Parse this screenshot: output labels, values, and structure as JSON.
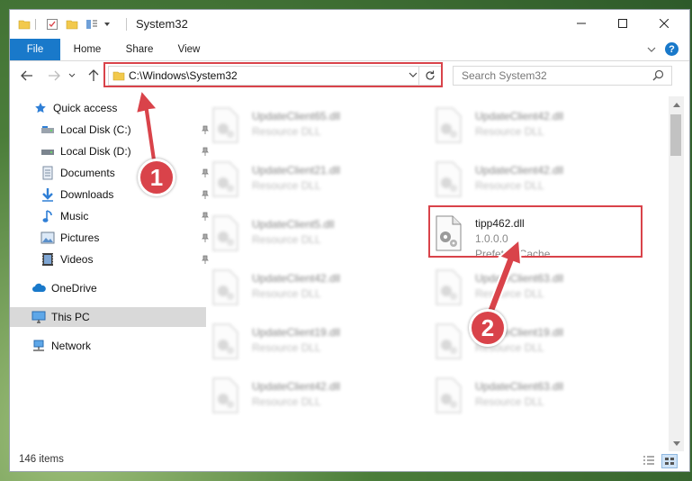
{
  "window": {
    "title": "System32"
  },
  "ribbon": {
    "tabs": [
      "File",
      "Home",
      "Share",
      "View"
    ]
  },
  "address": {
    "path": "C:\\Windows\\System32"
  },
  "search": {
    "placeholder": "Search System32"
  },
  "nav": {
    "quick_access": "Quick access",
    "items": [
      {
        "label": "Local Disk (C:)",
        "icon": "drive-icon"
      },
      {
        "label": "Local Disk (D:)",
        "icon": "drive-icon"
      },
      {
        "label": "Documents",
        "icon": "documents-icon"
      },
      {
        "label": "Downloads",
        "icon": "downloads-icon"
      },
      {
        "label": "Music",
        "icon": "music-icon"
      },
      {
        "label": "Pictures",
        "icon": "pictures-icon"
      },
      {
        "label": "Videos",
        "icon": "videos-icon"
      }
    ],
    "onedrive": "OneDrive",
    "this_pc": "This PC",
    "network": "Network"
  },
  "files": {
    "left": [
      {
        "name": "UpdateClient65.dll",
        "type": "Resource DLL"
      },
      {
        "name": "UpdateClient21.dll",
        "type": "Resource DLL"
      },
      {
        "name": "UpdateClient5.dll",
        "type": "Resource DLL"
      },
      {
        "name": "UpdateClient42.dll",
        "type": "Resource DLL"
      },
      {
        "name": "UpdateClient19.dll",
        "type": "Resource DLL"
      },
      {
        "name": "UpdateClient42.dll",
        "type": "Resource DLL"
      }
    ],
    "right": [
      {
        "name": "UpdateClient42.dll",
        "type": "Resource DLL"
      },
      {
        "name": "UpdateClient42.dll",
        "type": "Resource DLL"
      },
      {
        "name": "tipp462.dll",
        "version": "1.0.0.0",
        "type": "Prefetch-Cache"
      },
      {
        "name": "UpdateClient63.dll",
        "type": "Resource DLL"
      },
      {
        "name": "UpdateClient19.dll",
        "type": "Resource DLL"
      },
      {
        "name": "UpdateClient63.dll",
        "type": "Resource DLL"
      }
    ]
  },
  "status": {
    "count": "146 items"
  },
  "annotations": {
    "step1": "1",
    "step2": "2",
    "color": "#d9434a"
  }
}
